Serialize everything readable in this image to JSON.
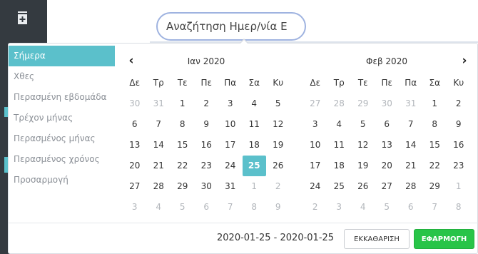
{
  "search": {
    "value": "Αναζήτηση Ημερ/νία Ε"
  },
  "ranges": [
    {
      "label": "Σήμερα",
      "active": true
    },
    {
      "label": "Χθες",
      "active": false
    },
    {
      "label": "Περασμένη εβδομάδα",
      "active": false
    },
    {
      "label": "Τρέχον μήνας",
      "active": false
    },
    {
      "label": "Περασμένος μήνας",
      "active": false
    },
    {
      "label": "Περασμένος χρόνος",
      "active": false
    },
    {
      "label": "Προσαρμογή",
      "active": false
    }
  ],
  "weekdays": [
    "Δε",
    "Τρ",
    "Τε",
    "Πε",
    "Πα",
    "Σα",
    "Κυ"
  ],
  "calendars": [
    {
      "title": "Ιαν 2020",
      "weeks": [
        [
          "30",
          "31",
          "1",
          "2",
          "3",
          "4",
          "5"
        ],
        [
          "6",
          "7",
          "8",
          "9",
          "10",
          "11",
          "12"
        ],
        [
          "13",
          "14",
          "15",
          "16",
          "17",
          "18",
          "19"
        ],
        [
          "20",
          "21",
          "22",
          "23",
          "24",
          "25",
          "26"
        ],
        [
          "27",
          "28",
          "29",
          "30",
          "31",
          "1",
          "2"
        ],
        [
          "3",
          "4",
          "5",
          "6",
          "7",
          "8",
          "9"
        ]
      ],
      "off": [
        [
          0,
          0
        ],
        [
          0,
          1
        ],
        [
          4,
          5
        ],
        [
          4,
          6
        ],
        [
          5,
          0
        ],
        [
          5,
          1
        ],
        [
          5,
          2
        ],
        [
          5,
          3
        ],
        [
          5,
          4
        ],
        [
          5,
          5
        ],
        [
          5,
          6
        ]
      ],
      "selected": [
        3,
        5
      ]
    },
    {
      "title": "Φεβ 2020",
      "weeks": [
        [
          "27",
          "28",
          "29",
          "30",
          "31",
          "1",
          "2"
        ],
        [
          "3",
          "4",
          "5",
          "6",
          "7",
          "8",
          "9"
        ],
        [
          "10",
          "11",
          "12",
          "13",
          "14",
          "15",
          "16"
        ],
        [
          "17",
          "18",
          "19",
          "20",
          "21",
          "22",
          "23"
        ],
        [
          "24",
          "25",
          "26",
          "27",
          "28",
          "29",
          "1"
        ],
        [
          "2",
          "3",
          "4",
          "5",
          "6",
          "7",
          "8"
        ]
      ],
      "off": [
        [
          0,
          0
        ],
        [
          0,
          1
        ],
        [
          0,
          2
        ],
        [
          0,
          3
        ],
        [
          0,
          4
        ],
        [
          4,
          6
        ],
        [
          5,
          0
        ],
        [
          5,
          1
        ],
        [
          5,
          2
        ],
        [
          5,
          3
        ],
        [
          5,
          4
        ],
        [
          5,
          5
        ],
        [
          5,
          6
        ]
      ],
      "selected": null
    }
  ],
  "footer": {
    "range_text": "2020-01-25 - 2020-01-25",
    "clear_label": "ΕΚΚΑΘΑΡΙΣΗ",
    "apply_label": "ΕΦΑΡΜΟΓΗ"
  },
  "colors": {
    "accent": "#5bc0cb",
    "apply": "#28c448",
    "sidebar": "#343a40"
  },
  "icons": {
    "sidebar": "add-document-icon",
    "prev": "chevron-left-icon",
    "next": "chevron-right-icon"
  }
}
